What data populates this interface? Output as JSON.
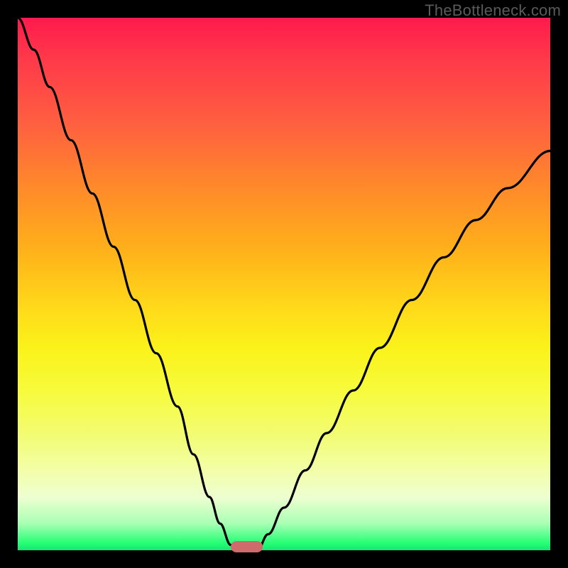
{
  "watermark": "TheBottleneck.com",
  "chart_data": {
    "type": "line",
    "title": "",
    "xlabel": "",
    "ylabel": "",
    "xlim": [
      0,
      100
    ],
    "ylim": [
      0,
      100
    ],
    "grid": false,
    "series": [
      {
        "name": "left-curve",
        "x": [
          0,
          3,
          6,
          10,
          14,
          18,
          22,
          26,
          30,
          33,
          36,
          38,
          40,
          41
        ],
        "values": [
          100,
          94,
          87,
          77,
          67,
          57,
          47,
          37,
          27,
          18,
          10,
          5,
          1,
          0
        ]
      },
      {
        "name": "right-curve",
        "x": [
          45,
          47,
          50,
          54,
          58,
          63,
          68,
          74,
          80,
          86,
          92,
          100
        ],
        "values": [
          0,
          3,
          8,
          15,
          22,
          30,
          38,
          47,
          55,
          62,
          68,
          75
        ]
      }
    ],
    "marker": {
      "x_start": 40,
      "x_end": 46,
      "y": 0
    },
    "gradient_note": "vertical background gradient red→orange→yellow→pale→green"
  },
  "colors": {
    "page_bg": "#000000",
    "curve_stroke": "#000000",
    "marker_fill": "#cf6b6b",
    "watermark": "#5a5a5a"
  }
}
